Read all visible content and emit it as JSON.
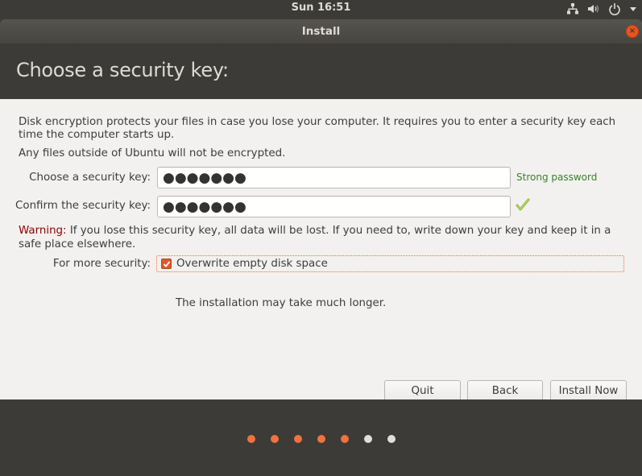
{
  "top_bar": {
    "clock": "Sun 16:51",
    "tray_icons": [
      "network-icon",
      "volume-icon",
      "power-icon",
      "menu-dropdown-icon"
    ]
  },
  "window": {
    "title": "Install",
    "close_icon": "close-icon"
  },
  "header": {
    "title": "Choose a security key:"
  },
  "content": {
    "intro": "Disk encryption protects your files in case you lose your computer. It requires you to enter a security key each time the computer starts up.",
    "intro2": "Any files outside of Ubuntu will not be encrypted.",
    "fields": [
      {
        "label": "Choose a security key:",
        "value": "●●●●●●●",
        "status": "Strong password"
      },
      {
        "label": "Confirm the security key:",
        "value": "●●●●●●●",
        "status_icon": "checkmark-icon"
      }
    ],
    "warning_label": "Warning:",
    "warning_text": " If you lose this security key, all data will be lost. If you need to, write down your key and keep it in a safe place elsewhere.",
    "security_label": "For more security:",
    "overwrite_checkbox": {
      "label": "Overwrite empty disk space",
      "checked": true
    },
    "overwrite_note": "The installation may take much longer."
  },
  "buttons": {
    "quit": "Quit",
    "back": "Back",
    "install_now": "Install Now"
  },
  "progress": {
    "total_steps": 7,
    "completed_steps": 5,
    "colors": {
      "done": "#ee7340",
      "todo": "#dededc"
    }
  },
  "colors": {
    "accent": "#e95420",
    "strength_ok": "#3a7f2a",
    "warning": "#8b0000"
  }
}
